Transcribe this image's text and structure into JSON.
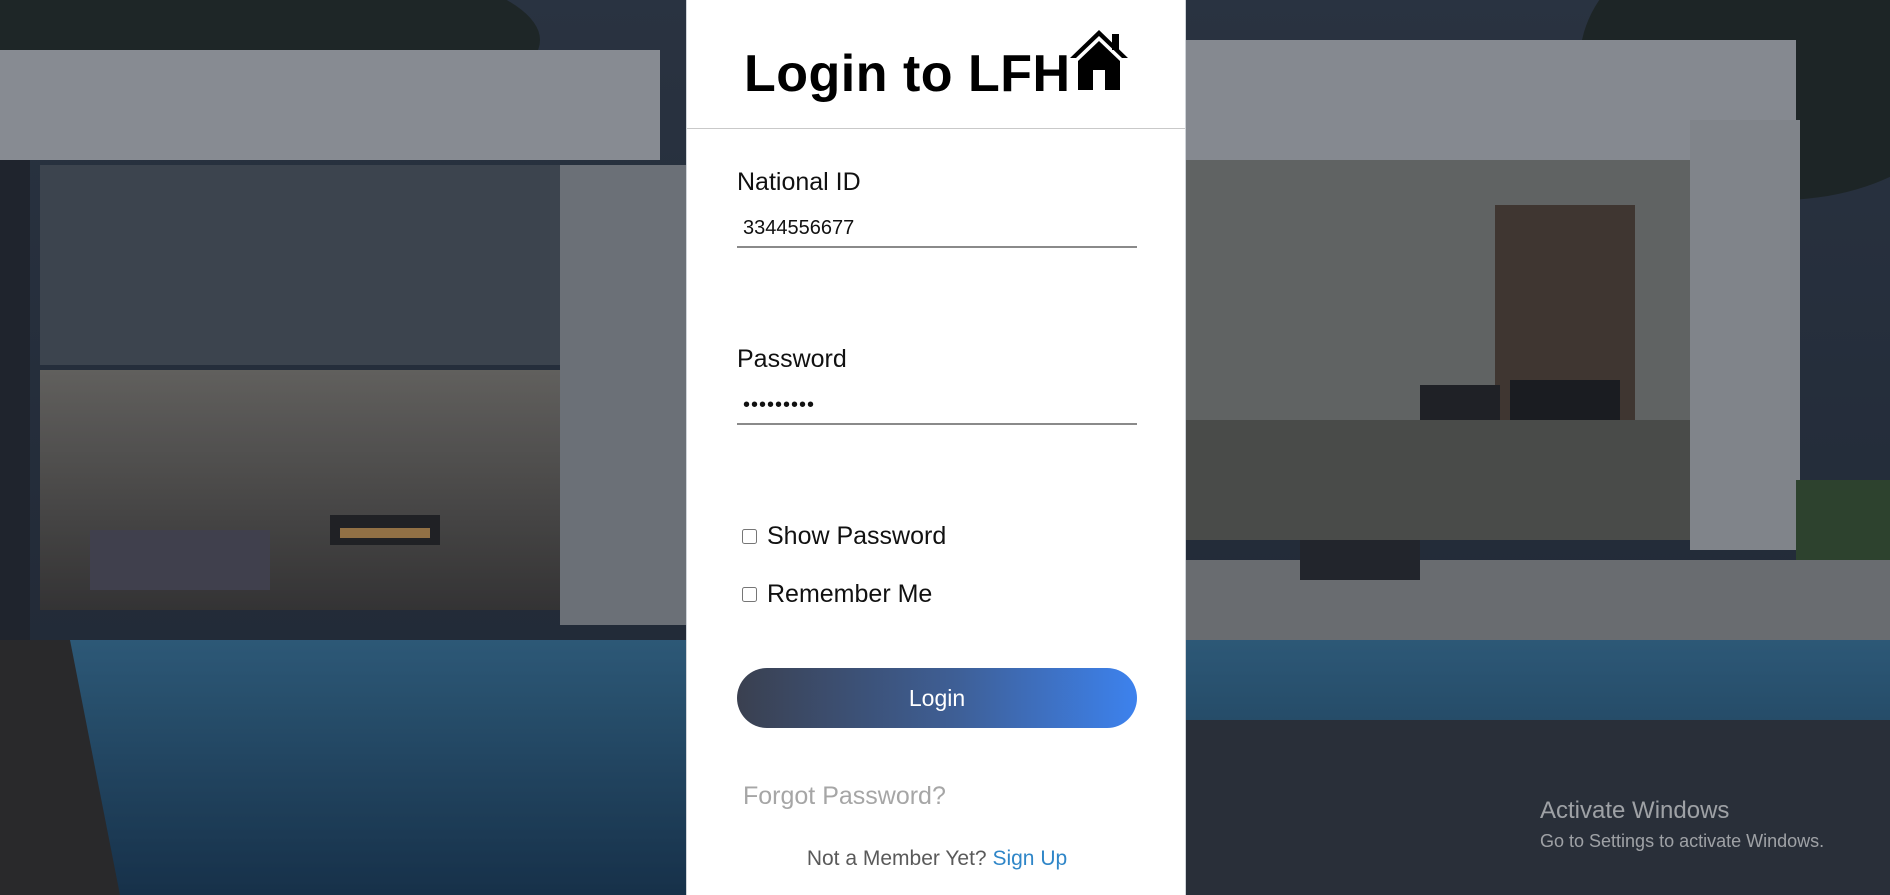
{
  "header": {
    "title": "Login to LFH",
    "icon": "house-icon"
  },
  "form": {
    "national_id": {
      "label": "National ID",
      "value": "3344556677"
    },
    "password": {
      "label": "Password",
      "value": "•••••••••"
    },
    "show_password": {
      "label": "Show Password",
      "checked": false
    },
    "remember_me": {
      "label": "Remember Me",
      "checked": false
    },
    "login_label": "Login",
    "forgot_password": "Forgot Password?",
    "signup_prompt": "Not a Member Yet?",
    "signup_link": "Sign Up"
  },
  "watermark": {
    "title": "Activate Windows",
    "subtitle": "Go to Settings to activate Windows."
  },
  "colors": {
    "login_gradient_start": "#3a4050",
    "login_gradient_end": "#3d82ee",
    "signup_link": "#2f86c8",
    "forgot_link": "#a6a6a6"
  }
}
